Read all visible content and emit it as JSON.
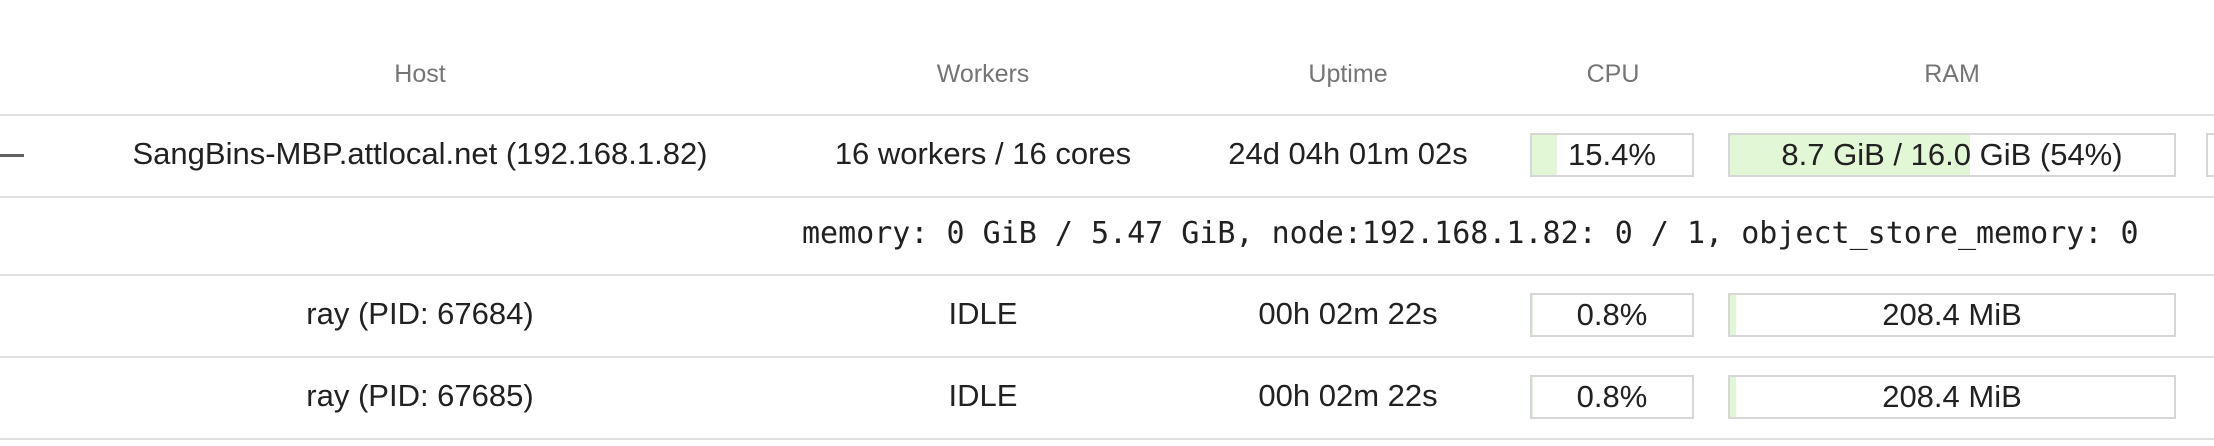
{
  "colors": {
    "usage_fill": "#e2f7d5",
    "usage_fill_overlap": "#e8e5cf",
    "border": "#e0e0e0",
    "header_text": "#757575"
  },
  "header": {
    "host": "Host",
    "workers": "Workers",
    "uptime": "Uptime",
    "cpu": "CPU",
    "ram": "RAM"
  },
  "node": {
    "collapse_icon": "minus-icon",
    "host": "SangBins-MBP.attlocal.net (192.168.1.82)",
    "workers": "16 workers / 16 cores",
    "uptime": "24d 04h 01m 02s",
    "cpu": {
      "label": "15.4%",
      "percent": 15.4
    },
    "ram": {
      "label": "8.7 GiB / 16.0 GiB (54%)",
      "percent": 54
    }
  },
  "resources_line": "memory: 0 GiB / 5.47 GiB, node:192.168.1.82: 0 / 1, object_store_memory: 0",
  "workers": [
    {
      "host": "ray (PID: 67684)",
      "status": "IDLE",
      "uptime": "00h 02m 22s",
      "cpu": {
        "label": "0.8%",
        "percent": 0.8
      },
      "ram": {
        "label": "208.4 MiB",
        "percent": 1.3
      }
    },
    {
      "host": "ray (PID: 67685)",
      "status": "IDLE",
      "uptime": "00h 02m 22s",
      "cpu": {
        "label": "0.8%",
        "percent": 0.8
      },
      "ram": {
        "label": "208.4 MiB",
        "percent": 1.3
      }
    }
  ]
}
